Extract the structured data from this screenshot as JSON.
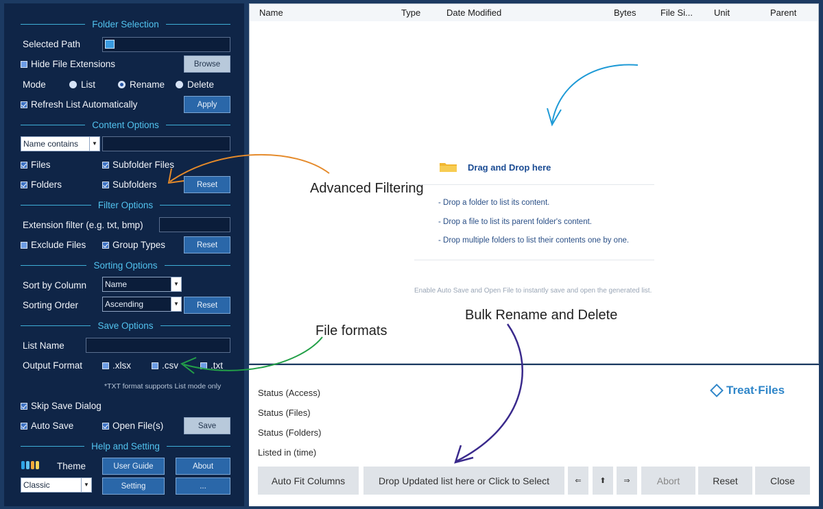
{
  "sidebar": {
    "folder_selection": {
      "title": "Folder Selection",
      "selected_path_label": "Selected Path",
      "hide_ext_label": "Hide File Extensions",
      "browse_label": "Browse",
      "mode_label": "Mode",
      "mode_list": "List",
      "mode_rename": "Rename",
      "mode_delete": "Delete",
      "refresh_label": "Refresh List Automatically",
      "apply_label": "Apply"
    },
    "content_options": {
      "title": "Content Options",
      "filter_value": "Name contains",
      "files_label": "Files",
      "subfolder_files_label": "Subfolder Files",
      "folders_label": "Folders",
      "subfolders_label": "Subfolders",
      "reset_label": "Reset"
    },
    "filter_options": {
      "title": "Filter Options",
      "ext_label": "Extension filter (e.g. txt, bmp)",
      "exclude_label": "Exclude Files",
      "group_label": "Group Types",
      "reset_label": "Reset"
    },
    "sorting_options": {
      "title": "Sorting Options",
      "sort_by_label": "Sort by Column",
      "sort_by_value": "Name",
      "order_label": "Sorting Order",
      "order_value": "Ascending",
      "reset_label": "Reset"
    },
    "save_options": {
      "title": "Save Options",
      "list_name_label": "List Name",
      "output_label": "Output Format",
      "xlsx": ".xlsx",
      "csv": ".csv",
      "txt": ".txt",
      "txt_note": "*TXT format supports List mode only",
      "skip_label": "Skip Save Dialog",
      "auto_save_label": "Auto Save",
      "open_file_label": "Open File(s)",
      "save_label": "Save"
    },
    "help": {
      "title": "Help and Setting",
      "theme_label": "Theme",
      "theme_value": "Classic",
      "user_guide_label": "User Guide",
      "about_label": "About",
      "setting_label": "Setting",
      "more_label": "..."
    }
  },
  "list": {
    "columns": [
      "Name",
      "Type",
      "Date Modified",
      "Bytes",
      "File Si...",
      "Unit",
      "Parent"
    ],
    "drop_title": "Drag and Drop here",
    "drop_items": [
      "- Drop a folder to list its content.",
      "- Drop a file to list its parent folder's content.",
      "- Drop multiple folders to list their contents one by one."
    ],
    "hint": "Enable Auto Save and Open File to instantly save and open the generated list."
  },
  "status": {
    "access": "Status (Access)",
    "files": "Status (Files)",
    "folders": "Status (Folders)",
    "listed": "Listed in (time)"
  },
  "brand": "Treat·Files",
  "buttons": {
    "auto_fit": "Auto Fit Columns",
    "drop_updated": "Drop Updated list here or Click to Select",
    "left": "⇐",
    "up": "⬆",
    "right": "⇒",
    "abort": "Abort",
    "reset": "Reset",
    "close": "Close"
  },
  "annotations": {
    "advanced": "Advanced Filtering",
    "formats": "File formats",
    "bulk": "Bulk Rename and Delete"
  },
  "colors": {
    "accent": "#52c3ef",
    "sidebar_bg": "#0f2547",
    "arrow_blue": "#1e9ad6",
    "arrow_orange": "#e58a2a",
    "arrow_green": "#23a048",
    "arrow_purple": "#3a2a8c"
  }
}
